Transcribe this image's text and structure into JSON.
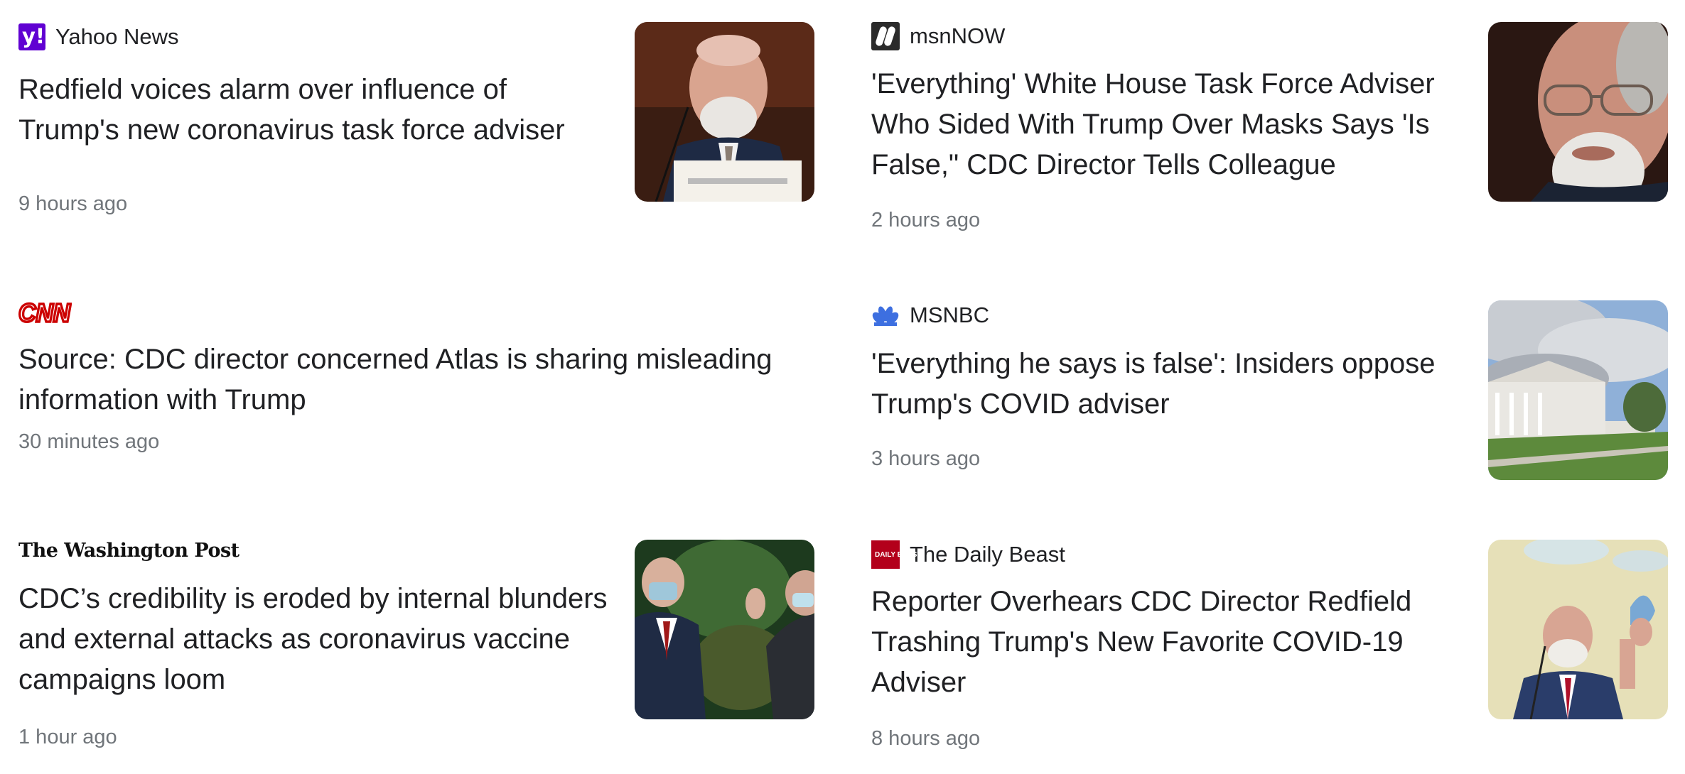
{
  "articles": [
    {
      "source": "Yahoo News",
      "logo_icon": "yahoo-logo-icon",
      "headline": "Redfield voices alarm over influence of Trump's new coronavirus task force adviser",
      "time": "9 hours ago",
      "image": "redfield-testifying-thumbnail"
    },
    {
      "source": "msnNOW",
      "logo_icon": "msnnow-logo-icon",
      "headline": "'Everything' White House Task Force Adviser Who Sided With Trump Over Masks Says 'Is False,\" CDC Director Tells Colleague",
      "time": "2 hours ago",
      "image": "redfield-closeup-thumbnail"
    },
    {
      "source": "CNN",
      "logo_icon": "cnn-logo-icon",
      "headline": "Source: CDC director concerned Atlas is sharing misleading information with Trump",
      "time": "30 minutes ago"
    },
    {
      "source": "MSNBC",
      "logo_icon": "nbc-peacock-icon",
      "headline": "'Everything he says is false': Insiders oppose Trump's COVID adviser",
      "time": "3 hours ago",
      "image": "white-house-thumbnail"
    },
    {
      "source": "The Washington Post",
      "logo_icon": "washington-post-logo-icon",
      "headline": "CDC’s credibility is eroded by internal blunders and external attacks as coronavirus vaccine campaigns loom",
      "time": "1 hour ago",
      "image": "masked-officials-thumbnail"
    },
    {
      "source": "The Daily Beast",
      "logo_icon": "daily-beast-logo-icon",
      "logo_text": "DAILY BEAST",
      "headline": "Reporter Overhears CDC Director Redfield Trashing Trump's New Favorite COVID-19 Adviser",
      "time": "8 hours ago",
      "image": "redfield-holding-mask-thumbnail"
    }
  ],
  "colors": {
    "yahoo": "#6001d2",
    "cnn": "#cc0000",
    "nbc": "#3d6fe0",
    "daily_beast": "#b3001b",
    "time": "#70757a"
  }
}
